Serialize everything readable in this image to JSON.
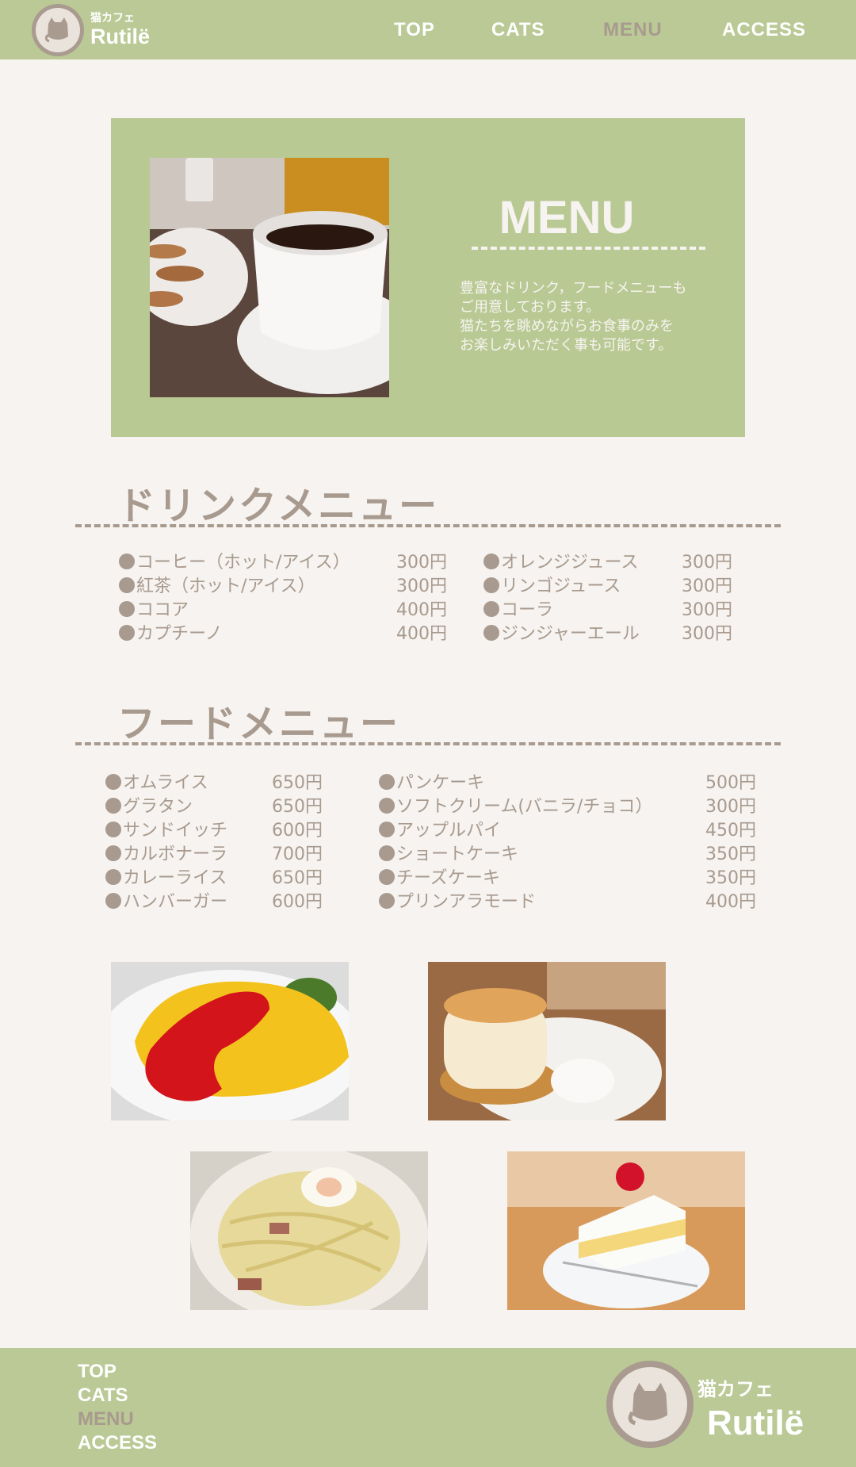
{
  "header": {
    "logo_sub": "猫カフェ",
    "logo_name": "Rutilё",
    "nav": [
      "TOP",
      "CATS",
      "MENU",
      "ACCESS"
    ],
    "active": "MENU"
  },
  "hero": {
    "title": "MENU",
    "text": "豊富なドリンク，フードメニューも\nご用意しております。\n猫たちを眺めながらお食事のみを\nお楽しみいただく事も可能です。"
  },
  "drink": {
    "title": "ドリンクメニュー",
    "left": [
      {
        "name": "コーヒー（ホット/アイス）",
        "price": "300円"
      },
      {
        "name": "紅茶（ホット/アイス）",
        "price": "300円"
      },
      {
        "name": "ココア",
        "price": "400円"
      },
      {
        "name": "カプチーノ",
        "price": "400円"
      }
    ],
    "right": [
      {
        "name": "オレンジジュース",
        "price": "300円"
      },
      {
        "name": "リンゴジュース",
        "price": "300円"
      },
      {
        "name": "コーラ",
        "price": "300円"
      },
      {
        "name": "ジンジャーエール",
        "price": "300円"
      }
    ]
  },
  "food": {
    "title": "フードメニュー",
    "left": [
      {
        "name": "オムライス",
        "price": "650円"
      },
      {
        "name": "グラタン",
        "price": "650円"
      },
      {
        "name": "サンドイッチ",
        "price": "600円"
      },
      {
        "name": "カルボナーラ",
        "price": "700円"
      },
      {
        "name": "カレーライス",
        "price": "650円"
      },
      {
        "name": "ハンバーガー",
        "price": "600円"
      }
    ],
    "right": [
      {
        "name": "パンケーキ",
        "price": "500円"
      },
      {
        "name": "ソフトクリーム(バニラ/チョコ）",
        "price": "300円"
      },
      {
        "name": "アップルパイ",
        "price": "450円"
      },
      {
        "name": "ショートケーキ",
        "price": "350円"
      },
      {
        "name": "チーズケーキ",
        "price": "350円"
      },
      {
        "name": "プリンアラモード",
        "price": "400円"
      }
    ]
  },
  "photos": [
    "omurice-photo",
    "pancake-photo",
    "carbonara-photo",
    "shortcake-photo"
  ],
  "footer": {
    "nav": [
      "TOP",
      "CATS",
      "MENU",
      "ACCESS"
    ],
    "logo_sub": "猫カフェ",
    "logo_name": "Rutilё"
  },
  "colors": {
    "green": "#bac995",
    "brown": "#a89a8e",
    "background": "#f6f3f0"
  }
}
